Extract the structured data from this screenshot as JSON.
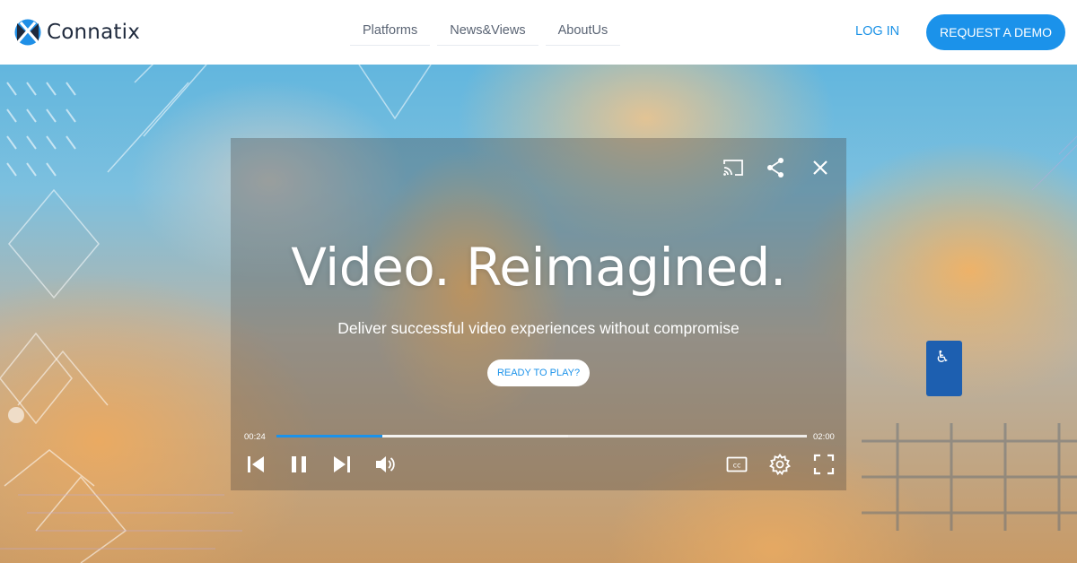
{
  "brand": {
    "name": "Connatix",
    "logo_icon": "connatix-x-logo",
    "accent": "#1b92ea"
  },
  "nav": {
    "items": [
      {
        "label": "Platforms"
      },
      {
        "label": "News&Views"
      },
      {
        "label": "AboutUs"
      }
    ]
  },
  "header": {
    "login_label": "LOG IN",
    "demo_label": "REQUEST A DEMO"
  },
  "player": {
    "headline": "Video. Reimagined.",
    "subheadline": "Deliver successful video experiences without compromise",
    "cta_label": "READY TO PLAY?",
    "current_time": "00:24",
    "duration": "02:00",
    "progress_fraction": 0.2,
    "icons": {
      "top": [
        "cast-icon",
        "share-icon",
        "close-icon"
      ],
      "bottom_left": [
        "skip-previous-icon",
        "pause-icon",
        "skip-next-icon",
        "volume-icon"
      ],
      "bottom_right": [
        "closed-captions-icon",
        "settings-gear-icon",
        "fullscreen-icon"
      ]
    }
  }
}
